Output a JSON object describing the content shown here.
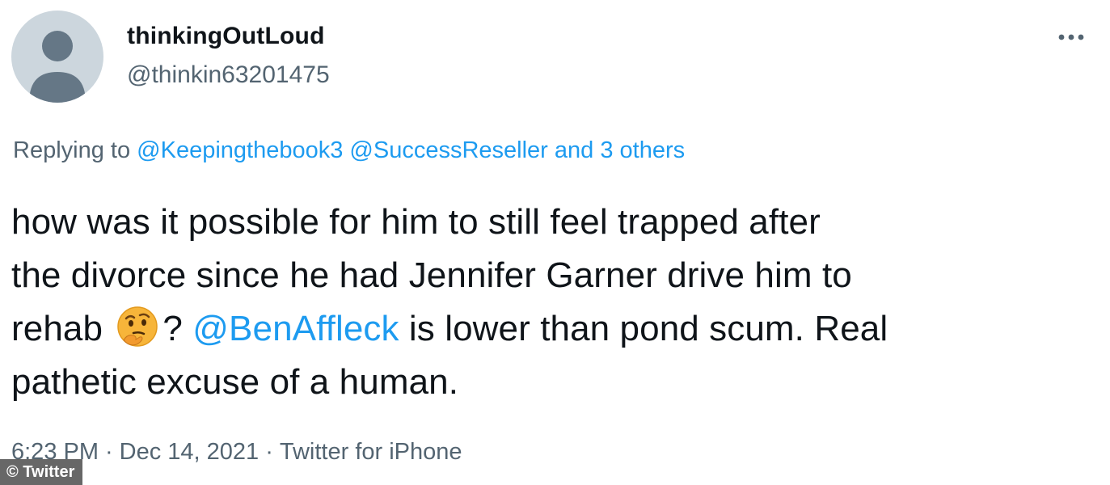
{
  "user": {
    "display_name": "thinkingOutLoud",
    "handle": "@thinkin63201475"
  },
  "reply": {
    "prefix": "Replying to",
    "mentions": [
      "@Keepingthebook3",
      "@SuccessReseller"
    ],
    "others": "and 3 others"
  },
  "tweet": {
    "line1": "how was it possible for him to still feel trapped after",
    "line2": "the divorce since he had Jennifer Garner drive him to",
    "line3_start": "rehab",
    "line3_emoji": "thinking-face",
    "line3_q": "?",
    "line3_mention": "@BenAffleck",
    "line3_end": "is lower than pond scum. Real",
    "line4": "pathetic excuse of a human."
  },
  "meta": {
    "time": "6:23 PM",
    "date": "Dec 14, 2021",
    "source": "Twitter for iPhone",
    "separator": "·"
  },
  "watermark": "© Twitter",
  "colors": {
    "link": "#1d9bf0",
    "secondary": "#536471",
    "text": "#0f1419",
    "avatar_bg": "#ccd6dd",
    "avatar_fg": "#657786"
  }
}
